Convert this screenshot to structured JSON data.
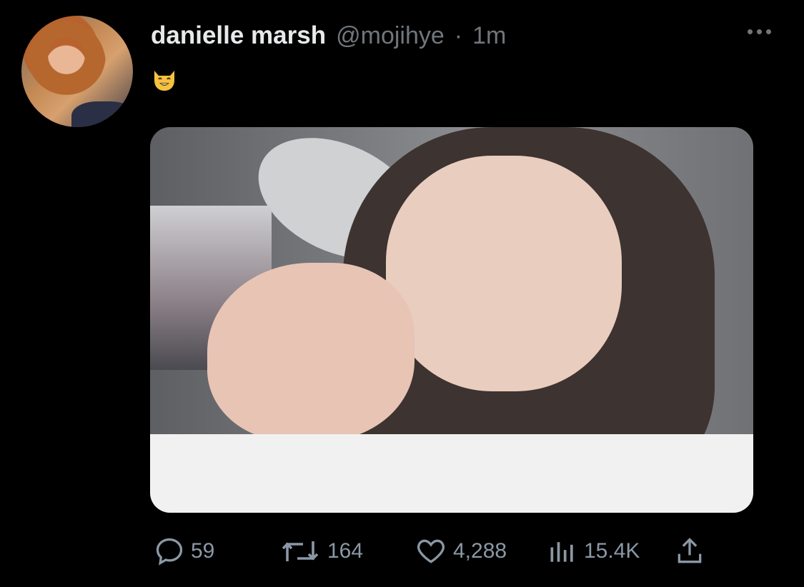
{
  "tweet": {
    "display_name": "danielle marsh",
    "handle": "@mojihye",
    "separator": "·",
    "time": "1m",
    "text_emoji": "😸"
  },
  "icons": {
    "more": "more-dots-icon",
    "reply": "reply-icon",
    "retweet": "retweet-icon",
    "like": "heart-icon",
    "views": "views-icon",
    "share": "share-icon"
  },
  "stats": {
    "replies": "59",
    "retweets": "164",
    "likes": "4,288",
    "views": "15.4K"
  },
  "colors": {
    "background": "#000000",
    "text": "#e7e9ea",
    "muted": "#71767b",
    "icon": "#8b98a5"
  }
}
